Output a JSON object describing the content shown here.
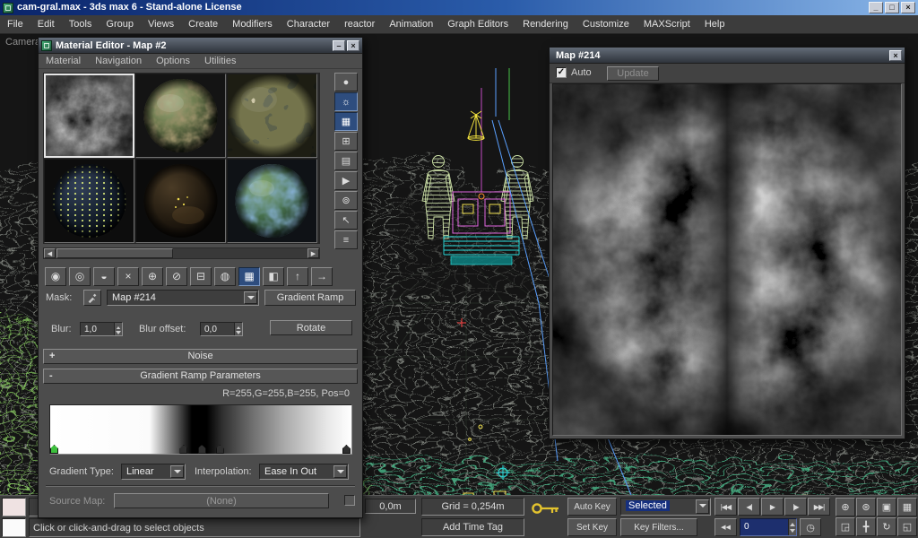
{
  "colors": {
    "titlebar_left": "#0a246a",
    "titlebar_right": "#8ab6e8",
    "accent_blue": "#2e4d7e",
    "selection_blue": "#16307e",
    "flag_green": "#3dbf3d",
    "key_yellow": "#e3c32e"
  },
  "window": {
    "title": "cam-gral.max - 3ds max 6 - Stand-alone License",
    "controls": [
      {
        "name": "minimize-button",
        "glyph": "_"
      },
      {
        "name": "maximize-button",
        "glyph": "□"
      },
      {
        "name": "close-button",
        "glyph": "×"
      }
    ]
  },
  "menubar": {
    "items": [
      "File",
      "Edit",
      "Tools",
      "Group",
      "Views",
      "Create",
      "Modifiers",
      "Character",
      "reactor",
      "Animation",
      "Graph Editors",
      "Rendering",
      "Customize",
      "MAXScript",
      "Help"
    ]
  },
  "viewport": {
    "label": "Camera"
  },
  "material_editor": {
    "title": "Material Editor - Map #2",
    "controls": [
      {
        "name": "me-minimize-button",
        "glyph": "–"
      },
      {
        "name": "me-close-button",
        "glyph": "×"
      }
    ],
    "menus": [
      "Material",
      "Navigation",
      "Options",
      "Utilities"
    ],
    "side_tools": [
      {
        "name": "sample-type-icon",
        "glyph": "●"
      },
      {
        "name": "backlight-icon",
        "glyph": "☼",
        "active": true
      },
      {
        "name": "background-icon",
        "glyph": "▦",
        "active": true
      },
      {
        "name": "sample-uv-tiling-icon",
        "glyph": "⊞"
      },
      {
        "name": "video-color-check-icon",
        "glyph": "▤"
      },
      {
        "name": "make-preview-icon",
        "glyph": "▶"
      },
      {
        "name": "options-icon",
        "glyph": "⊚"
      },
      {
        "name": "select-by-material-icon",
        "glyph": "↖"
      },
      {
        "name": "material-map-navigator-icon",
        "glyph": "≡"
      }
    ],
    "scrollbar": {
      "left_glyph": "◀",
      "right_glyph": "▶"
    },
    "toolbar": [
      {
        "name": "get-material-button",
        "glyph": "◉"
      },
      {
        "name": "put-material-to-scene-button",
        "glyph": "◎"
      },
      {
        "name": "assign-material-to-selection-button",
        "glyph": "◒"
      },
      {
        "name": "reset-map-button",
        "glyph": "×"
      },
      {
        "name": "make-material-copy-button",
        "glyph": "⊕"
      },
      {
        "name": "make-unique-button",
        "glyph": "⊘"
      },
      {
        "name": "put-to-library-button",
        "glyph": "⊟"
      },
      {
        "name": "material-id-channel-button",
        "glyph": "◍"
      },
      {
        "name": "show-map-in-viewport-button",
        "glyph": "▦",
        "active": true
      },
      {
        "name": "show-end-result-button",
        "glyph": "◧"
      },
      {
        "name": "go-to-parent-button",
        "glyph": "↑"
      },
      {
        "name": "go-forward-to-sibling-button",
        "glyph": "→"
      }
    ],
    "mask": {
      "label": "Mask:",
      "value": "Map #214",
      "type_button": "Gradient Ramp"
    },
    "coords_row": {
      "blur_label": "Blur:",
      "blur_value": "1,0",
      "blur_offset_label": "Blur offset:",
      "blur_offset_value": "0,0",
      "rotate_label": "Rotate"
    },
    "rollouts": {
      "noise": {
        "state": "+",
        "title": "Noise"
      },
      "gradient": {
        "state": "-",
        "title": "Gradient Ramp Parameters"
      }
    },
    "gradient": {
      "info": "R=255,G=255,B=255, Pos=0",
      "flags": [
        {
          "left_pct": 0,
          "color": "#3dbf3d"
        },
        {
          "left_pct": 43,
          "color": "#2e2e2e"
        },
        {
          "left_pct": 49,
          "color": "#2e2e2e"
        },
        {
          "left_pct": 55,
          "color": "#2e2e2e"
        },
        {
          "left_pct": 97,
          "color": "#2e2e2e"
        }
      ],
      "type_label": "Gradient Type:",
      "type_value": "Linear",
      "interp_label": "Interpolation:",
      "interp_value": "Ease In Out",
      "source_label": "Source Map:",
      "source_value": "(None)"
    }
  },
  "map_window": {
    "title": "Map #214",
    "controls": [
      {
        "name": "map-close-button",
        "glyph": "×"
      }
    ],
    "auto": "Auto",
    "update": "Update",
    "auto_check": "✓"
  },
  "status": {
    "prompt": "Click or click-and-drag to select objects",
    "coord": "0,0m",
    "grid": "Grid = 0,254m",
    "time_tag": "Add Time Tag",
    "auto_key": "Auto Key",
    "set_key": "Set Key",
    "selected": "Selected",
    "key_filters": "Key Filters...",
    "frame": "0",
    "key_mode_glyph": "◀◀",
    "time_config_glyph": "◷",
    "transport": [
      {
        "name": "go-to-start-button",
        "glyph": "|◀◀"
      },
      {
        "name": "previous-frame-button",
        "glyph": "◀|"
      },
      {
        "name": "play-button",
        "glyph": "▶"
      },
      {
        "name": "next-frame-button",
        "glyph": "|▶"
      },
      {
        "name": "go-to-end-button",
        "glyph": "▶▶|"
      }
    ],
    "nav": [
      {
        "name": "zoom-button",
        "glyph": "⊕"
      },
      {
        "name": "zoom-all-button",
        "glyph": "⊛"
      },
      {
        "name": "zoom-extents-button",
        "glyph": "▣"
      },
      {
        "name": "zoom-extents-all-button",
        "glyph": "▦"
      },
      {
        "name": "zoom-region-button",
        "glyph": "◲"
      },
      {
        "name": "pan-button",
        "glyph": "╋"
      },
      {
        "name": "arc-rotate-button",
        "glyph": "↻"
      },
      {
        "name": "min-max-toggle-button",
        "glyph": "◱"
      }
    ]
  }
}
